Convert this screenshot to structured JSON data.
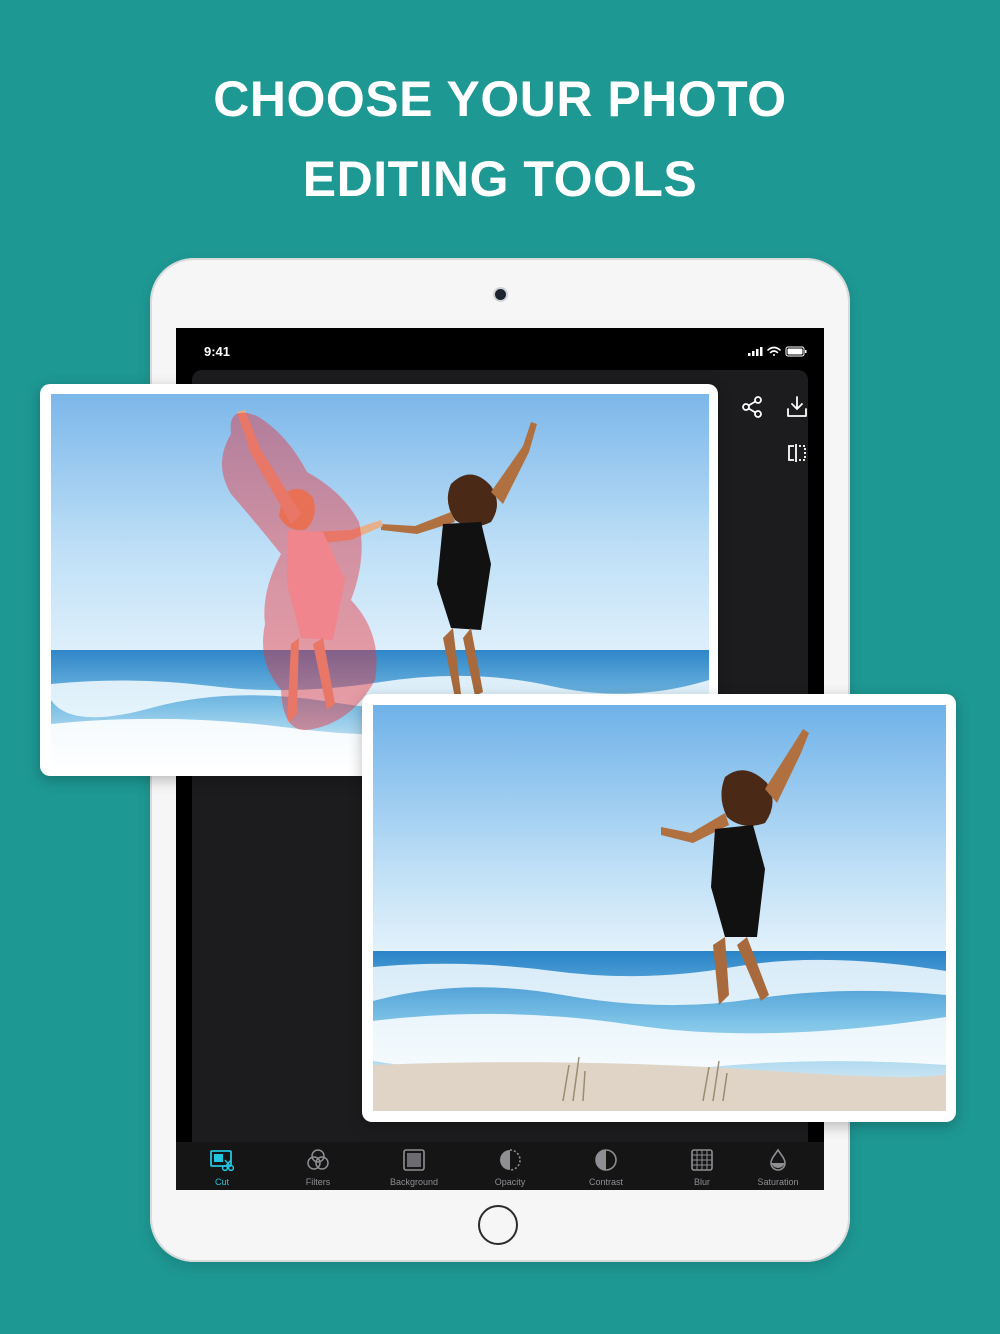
{
  "headline": {
    "line1": "CHOOSE YOUR PHOTO",
    "line2": "EDITING TOOLS"
  },
  "device": {
    "status_time": "9:41"
  },
  "colors": {
    "background": "#1e9893",
    "accent": "#21c6e0",
    "selection_overlay": "#e8323c"
  },
  "top_actions": [
    {
      "icon": "share-icon"
    },
    {
      "icon": "download-icon"
    },
    {
      "icon": "compare-icon"
    }
  ],
  "tabs": [
    {
      "label": "Cut",
      "icon": "cut-icon",
      "active": true
    },
    {
      "label": "Filters",
      "icon": "filters-icon",
      "active": false
    },
    {
      "label": "Background",
      "icon": "background-icon",
      "active": false
    },
    {
      "label": "Opacity",
      "icon": "opacity-icon",
      "active": false
    },
    {
      "label": "Contrast",
      "icon": "contrast-icon",
      "active": false
    },
    {
      "label": "Blur",
      "icon": "blur-icon",
      "active": false
    },
    {
      "label": "Saturation",
      "icon": "saturation-icon",
      "active": false
    }
  ]
}
